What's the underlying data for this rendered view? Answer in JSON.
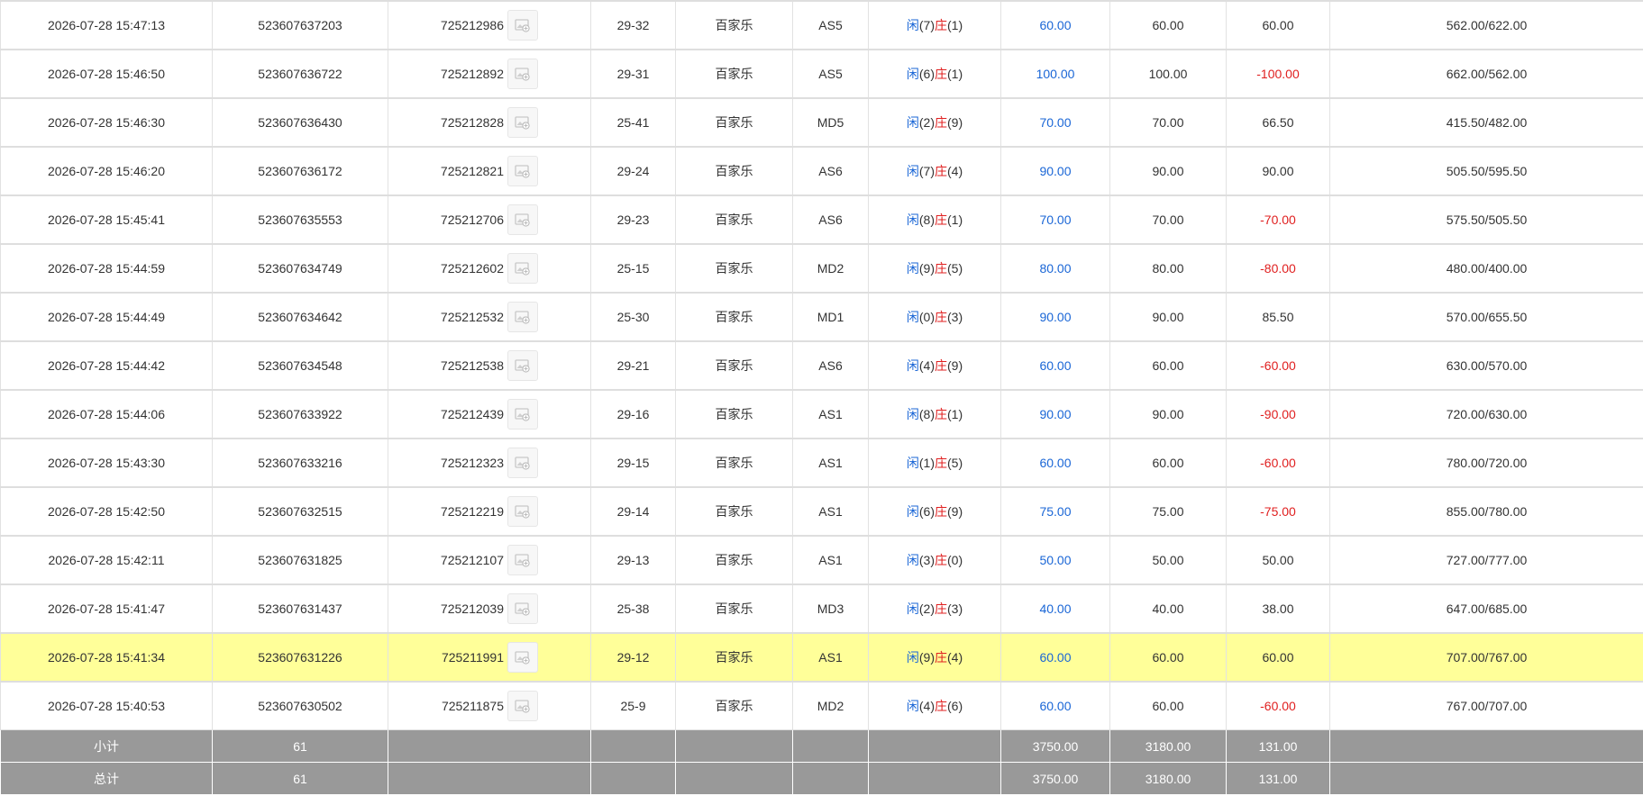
{
  "rows": [
    {
      "time": "2026-07-28 15:47:13",
      "order_id": "523607637203",
      "round_id": "725212986",
      "shoe": "29-32",
      "game": "百家乐",
      "table": "AS5",
      "player_label": "闲",
      "player_pt": "(7)",
      "banker_label": "庄",
      "banker_pt": "(1)",
      "bet": "60.00",
      "valid_bet": "60.00",
      "win_loss": "60.00",
      "win_loss_status": "positive",
      "balance": "562.00/622.00",
      "highlight": false
    },
    {
      "time": "2026-07-28 15:46:50",
      "order_id": "523607636722",
      "round_id": "725212892",
      "shoe": "29-31",
      "game": "百家乐",
      "table": "AS5",
      "player_label": "闲",
      "player_pt": "(6)",
      "banker_label": "庄",
      "banker_pt": "(1)",
      "bet": "100.00",
      "valid_bet": "100.00",
      "win_loss": "-100.00",
      "win_loss_status": "negative",
      "balance": "662.00/562.00",
      "highlight": false
    },
    {
      "time": "2026-07-28 15:46:30",
      "order_id": "523607636430",
      "round_id": "725212828",
      "shoe": "25-41",
      "game": "百家乐",
      "table": "MD5",
      "player_label": "闲",
      "player_pt": "(2)",
      "banker_label": "庄",
      "banker_pt": "(9)",
      "bet": "70.00",
      "valid_bet": "70.00",
      "win_loss": "66.50",
      "win_loss_status": "positive",
      "balance": "415.50/482.00",
      "highlight": false
    },
    {
      "time": "2026-07-28 15:46:20",
      "order_id": "523607636172",
      "round_id": "725212821",
      "shoe": "29-24",
      "game": "百家乐",
      "table": "AS6",
      "player_label": "闲",
      "player_pt": "(7)",
      "banker_label": "庄",
      "banker_pt": "(4)",
      "bet": "90.00",
      "valid_bet": "90.00",
      "win_loss": "90.00",
      "win_loss_status": "positive",
      "balance": "505.50/595.50",
      "highlight": false
    },
    {
      "time": "2026-07-28 15:45:41",
      "order_id": "523607635553",
      "round_id": "725212706",
      "shoe": "29-23",
      "game": "百家乐",
      "table": "AS6",
      "player_label": "闲",
      "player_pt": "(8)",
      "banker_label": "庄",
      "banker_pt": "(1)",
      "bet": "70.00",
      "valid_bet": "70.00",
      "win_loss": "-70.00",
      "win_loss_status": "negative",
      "balance": "575.50/505.50",
      "highlight": false
    },
    {
      "time": "2026-07-28 15:44:59",
      "order_id": "523607634749",
      "round_id": "725212602",
      "shoe": "25-15",
      "game": "百家乐",
      "table": "MD2",
      "player_label": "闲",
      "player_pt": "(9)",
      "banker_label": "庄",
      "banker_pt": "(5)",
      "bet": "80.00",
      "valid_bet": "80.00",
      "win_loss": "-80.00",
      "win_loss_status": "negative",
      "balance": "480.00/400.00",
      "highlight": false
    },
    {
      "time": "2026-07-28 15:44:49",
      "order_id": "523607634642",
      "round_id": "725212532",
      "shoe": "25-30",
      "game": "百家乐",
      "table": "MD1",
      "player_label": "闲",
      "player_pt": "(0)",
      "banker_label": "庄",
      "banker_pt": "(3)",
      "bet": "90.00",
      "valid_bet": "90.00",
      "win_loss": "85.50",
      "win_loss_status": "positive",
      "balance": "570.00/655.50",
      "highlight": false
    },
    {
      "time": "2026-07-28 15:44:42",
      "order_id": "523607634548",
      "round_id": "725212538",
      "shoe": "29-21",
      "game": "百家乐",
      "table": "AS6",
      "player_label": "闲",
      "player_pt": "(4)",
      "banker_label": "庄",
      "banker_pt": "(9)",
      "bet": "60.00",
      "valid_bet": "60.00",
      "win_loss": "-60.00",
      "win_loss_status": "negative",
      "balance": "630.00/570.00",
      "highlight": false
    },
    {
      "time": "2026-07-28 15:44:06",
      "order_id": "523607633922",
      "round_id": "725212439",
      "shoe": "29-16",
      "game": "百家乐",
      "table": "AS1",
      "player_label": "闲",
      "player_pt": "(8)",
      "banker_label": "庄",
      "banker_pt": "(1)",
      "bet": "90.00",
      "valid_bet": "90.00",
      "win_loss": "-90.00",
      "win_loss_status": "negative",
      "balance": "720.00/630.00",
      "highlight": false
    },
    {
      "time": "2026-07-28 15:43:30",
      "order_id": "523607633216",
      "round_id": "725212323",
      "shoe": "29-15",
      "game": "百家乐",
      "table": "AS1",
      "player_label": "闲",
      "player_pt": "(1)",
      "banker_label": "庄",
      "banker_pt": "(5)",
      "bet": "60.00",
      "valid_bet": "60.00",
      "win_loss": "-60.00",
      "win_loss_status": "negative",
      "balance": "780.00/720.00",
      "highlight": false
    },
    {
      "time": "2026-07-28 15:42:50",
      "order_id": "523607632515",
      "round_id": "725212219",
      "shoe": "29-14",
      "game": "百家乐",
      "table": "AS1",
      "player_label": "闲",
      "player_pt": "(6)",
      "banker_label": "庄",
      "banker_pt": "(9)",
      "bet": "75.00",
      "valid_bet": "75.00",
      "win_loss": "-75.00",
      "win_loss_status": "negative",
      "balance": "855.00/780.00",
      "highlight": false
    },
    {
      "time": "2026-07-28 15:42:11",
      "order_id": "523607631825",
      "round_id": "725212107",
      "shoe": "29-13",
      "game": "百家乐",
      "table": "AS1",
      "player_label": "闲",
      "player_pt": "(3)",
      "banker_label": "庄",
      "banker_pt": "(0)",
      "bet": "50.00",
      "valid_bet": "50.00",
      "win_loss": "50.00",
      "win_loss_status": "positive",
      "balance": "727.00/777.00",
      "highlight": false
    },
    {
      "time": "2026-07-28 15:41:47",
      "order_id": "523607631437",
      "round_id": "725212039",
      "shoe": "25-38",
      "game": "百家乐",
      "table": "MD3",
      "player_label": "闲",
      "player_pt": "(2)",
      "banker_label": "庄",
      "banker_pt": "(3)",
      "bet": "40.00",
      "valid_bet": "40.00",
      "win_loss": "38.00",
      "win_loss_status": "positive",
      "balance": "647.00/685.00",
      "highlight": false
    },
    {
      "time": "2026-07-28 15:41:34",
      "order_id": "523607631226",
      "round_id": "725211991",
      "shoe": "29-12",
      "game": "百家乐",
      "table": "AS1",
      "player_label": "闲",
      "player_pt": "(9)",
      "banker_label": "庄",
      "banker_pt": "(4)",
      "bet": "60.00",
      "valid_bet": "60.00",
      "win_loss": "60.00",
      "win_loss_status": "positive",
      "balance": "707.00/767.00",
      "highlight": true
    },
    {
      "time": "2026-07-28 15:40:53",
      "order_id": "523607630502",
      "round_id": "725211875",
      "shoe": "25-9",
      "game": "百家乐",
      "table": "MD2",
      "player_label": "闲",
      "player_pt": "(4)",
      "banker_label": "庄",
      "banker_pt": "(6)",
      "bet": "60.00",
      "valid_bet": "60.00",
      "win_loss": "-60.00",
      "win_loss_status": "negative",
      "balance": "767.00/707.00",
      "highlight": false
    }
  ],
  "subtotal": {
    "label": "小计",
    "count": "61",
    "bet": "3750.00",
    "valid_bet": "3180.00",
    "win_loss": "131.00"
  },
  "total": {
    "label": "总计",
    "count": "61",
    "bet": "3750.00",
    "valid_bet": "3180.00",
    "win_loss": "131.00"
  },
  "icons": {
    "round_image": "game-result-image-icon"
  },
  "colors": {
    "player": "#1a66d6",
    "banker": "#e02020",
    "negative": "#e02020",
    "bet": "#1a66d6",
    "highlight_row": "#ffff99",
    "summary_bg": "#999999"
  }
}
